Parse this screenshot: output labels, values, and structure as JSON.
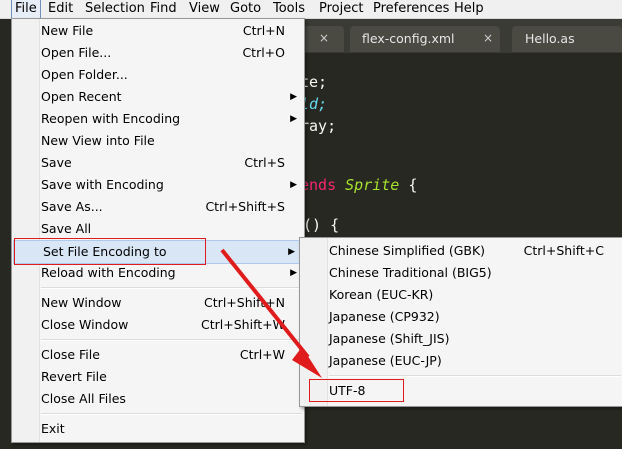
{
  "menubar": [
    {
      "label": "File",
      "active": true
    },
    {
      "label": "Edit"
    },
    {
      "label": "Selection"
    },
    {
      "label": "Find"
    },
    {
      "label": "View"
    },
    {
      "label": "Goto"
    },
    {
      "label": "Tools"
    },
    {
      "label": "Project"
    },
    {
      "label": "Preferences"
    },
    {
      "label": "Help"
    }
  ],
  "tabs": [
    {
      "label": "",
      "close": "×"
    },
    {
      "label": "flex-config.xml",
      "close": "×"
    },
    {
      "label": "Hello.as",
      "close": ""
    }
  ],
  "code": {
    "l1": "te;",
    "l2": "ld;",
    "l3": "ray;",
    "l4_kw": "ends",
    "l4_cls": "Sprite",
    "l4_rest": " {",
    "l5": "() {"
  },
  "file_menu": [
    {
      "label": "New File",
      "shortcut": "Ctrl+N"
    },
    {
      "label": "Open File...",
      "shortcut": "Ctrl+O"
    },
    {
      "label": "Open Folder...",
      "shortcut": ""
    },
    {
      "label": "Open Recent",
      "shortcut": "",
      "submenu": true
    },
    {
      "label": "Reopen with Encoding",
      "shortcut": "",
      "submenu": true
    },
    {
      "label": "New View into File",
      "shortcut": ""
    },
    {
      "label": "Save",
      "shortcut": "Ctrl+S"
    },
    {
      "label": "Save with Encoding",
      "shortcut": "",
      "submenu": true
    },
    {
      "label": "Save As...",
      "shortcut": "Ctrl+Shift+S"
    },
    {
      "label": "Save All",
      "shortcut": ""
    },
    {
      "label": "Set File Encoding to",
      "shortcut": "",
      "submenu": true,
      "highlighted": true
    },
    {
      "label": "Reload with Encoding",
      "shortcut": "",
      "submenu": true
    },
    {
      "separator": true
    },
    {
      "label": "New Window",
      "shortcut": "Ctrl+Shift+N"
    },
    {
      "label": "Close Window",
      "shortcut": "Ctrl+Shift+W"
    },
    {
      "separator": true
    },
    {
      "label": "Close File",
      "shortcut": "Ctrl+W"
    },
    {
      "label": "Revert File",
      "shortcut": ""
    },
    {
      "label": "Close All Files",
      "shortcut": ""
    },
    {
      "separator": true
    },
    {
      "label": "Exit",
      "shortcut": ""
    }
  ],
  "encoding_menu": [
    {
      "label": "Chinese Simplified (GBK)",
      "shortcut": "Ctrl+Shift+C"
    },
    {
      "label": "Chinese Traditional (BIG5)",
      "shortcut": ""
    },
    {
      "label": "Korean (EUC-KR)",
      "shortcut": ""
    },
    {
      "label": "Japanese (CP932)",
      "shortcut": ""
    },
    {
      "label": "Japanese (Shift_JIS)",
      "shortcut": ""
    },
    {
      "label": "Japanese (EUC-JP)",
      "shortcut": ""
    },
    {
      "separator": true
    },
    {
      "label": "UTF-8",
      "shortcut": ""
    }
  ],
  "colors": {
    "annotation": "#e01b1b",
    "menu_bg": "#f5f5f5",
    "editor_bg": "#272822"
  }
}
